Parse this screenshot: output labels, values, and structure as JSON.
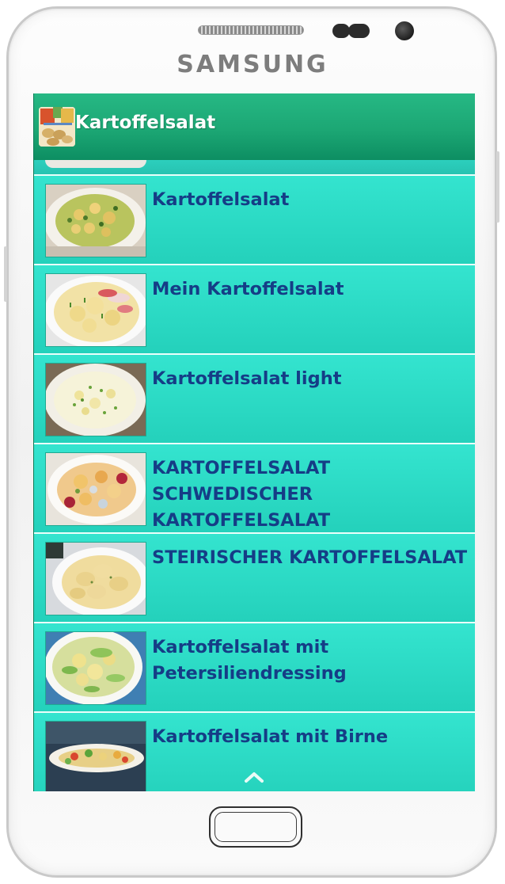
{
  "device": {
    "brand": "SAMSUNG"
  },
  "app": {
    "title": "Kartoffelsalat",
    "logo_icon": "potato-salad-logo"
  },
  "list": {
    "items": [
      {
        "title": "Kartoffelsalat",
        "image": "potato-salad-herbs-photo"
      },
      {
        "title": "Mein Kartoffelsalat",
        "image": "potato-salad-radish-photo"
      },
      {
        "title": "Kartoffelsalat light",
        "image": "potato-salad-light-photo"
      },
      {
        "title": "KARTOFFELSALAT SCHWEDISCHER KARTOFFELSALAT",
        "image": "swedish-potato-salad-photo"
      },
      {
        "title": "STEIRISCHER KARTOFFELSALAT",
        "image": "styrian-potato-salad-photo"
      },
      {
        "title": "Kartoffelsalat mit Petersiliendressing",
        "image": "potato-salad-parsley-photo"
      },
      {
        "title": "Kartoffelsalat mit Birne",
        "image": "potato-salad-pear-photo"
      }
    ]
  },
  "controls": {
    "scroll_up_icon": "chevron-up-icon"
  },
  "colors": {
    "appbar": "#1ca774",
    "list_background": "#2fdcc6",
    "item_title": "#153d86",
    "divider": "#eafffb"
  }
}
